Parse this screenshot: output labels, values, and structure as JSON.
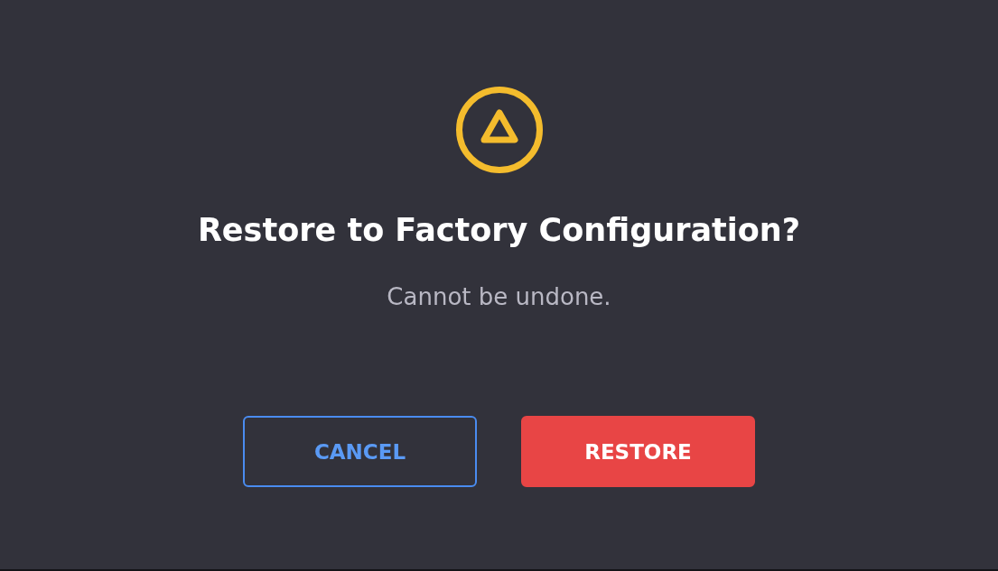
{
  "dialog": {
    "title": "Restore to Factory Configuration?",
    "message": "Cannot be undone.",
    "buttons": [
      {
        "label": "CANCEL",
        "kind": "outline"
      },
      {
        "label": "RESTORE",
        "kind": "danger"
      }
    ]
  }
}
